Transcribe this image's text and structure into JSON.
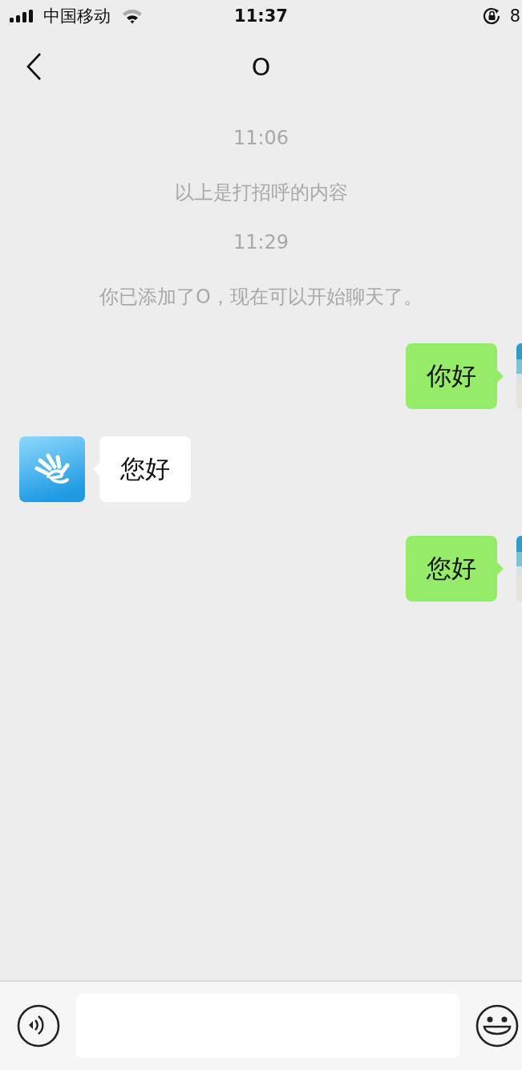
{
  "status_bar": {
    "carrier": "中国移动",
    "time": "11:37",
    "battery": "8"
  },
  "nav": {
    "title": "O"
  },
  "messages": [
    {
      "kind": "time",
      "text": "11:06"
    },
    {
      "kind": "system",
      "text": "以上是打招呼的内容"
    },
    {
      "kind": "time",
      "text": "11:29"
    },
    {
      "kind": "system",
      "text": "你已添加了O，现在可以开始聊天了。"
    },
    {
      "kind": "self",
      "text": "你好"
    },
    {
      "kind": "other",
      "text": "您好"
    },
    {
      "kind": "self",
      "text": "您好"
    }
  ]
}
